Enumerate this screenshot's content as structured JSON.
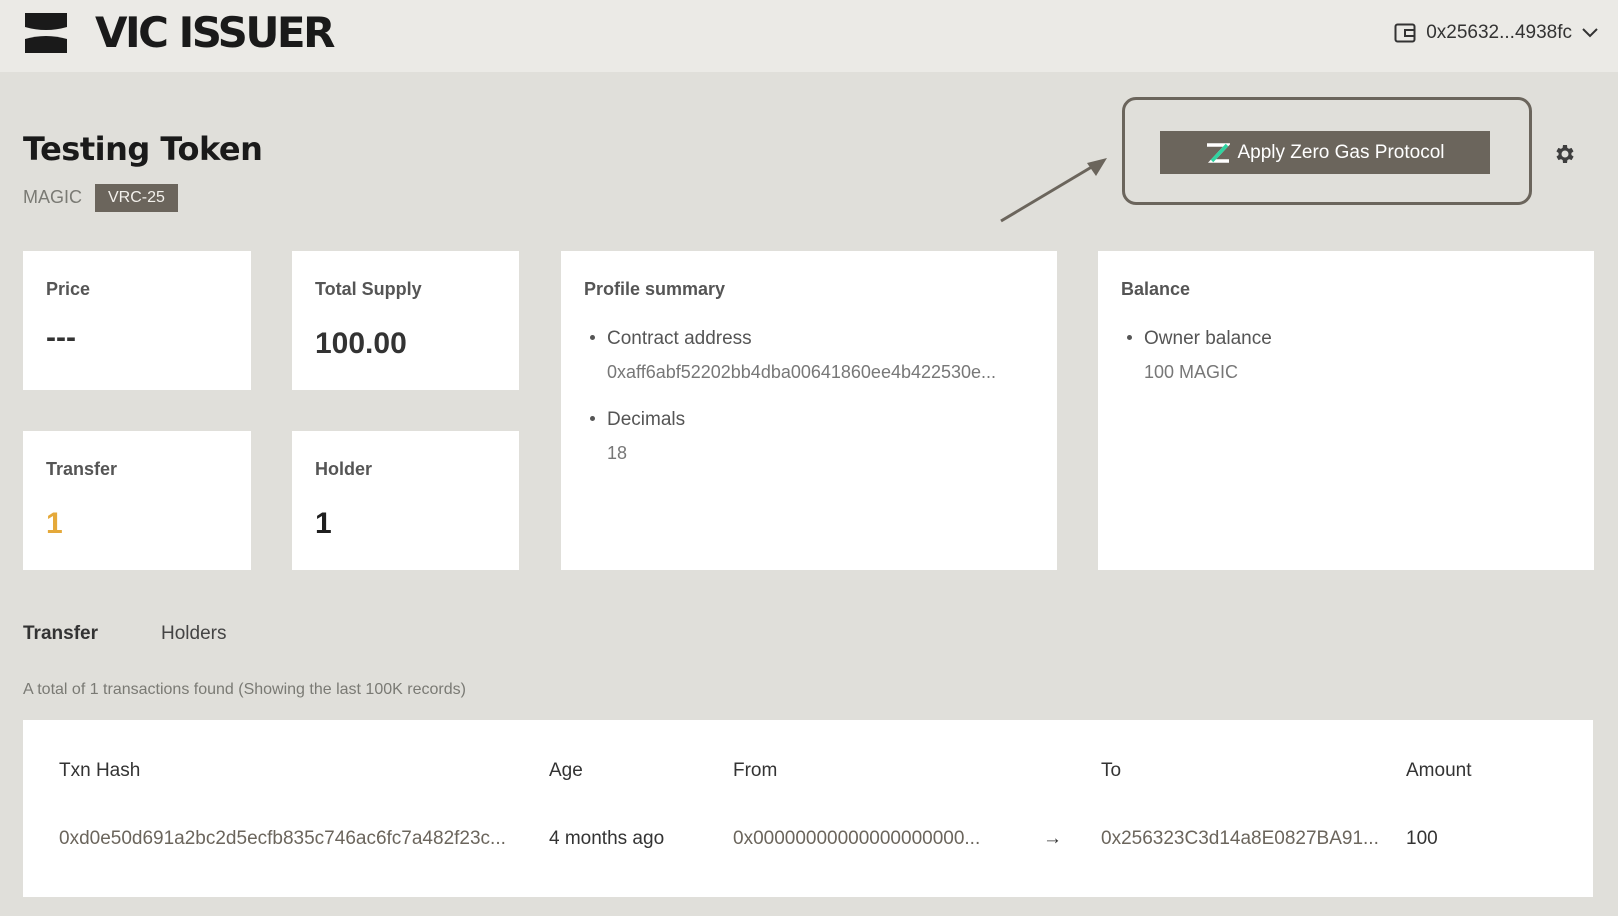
{
  "app": {
    "brand": "VIC ISSUER"
  },
  "wallet": {
    "address": "0x25632...4938fc"
  },
  "token": {
    "name": "Testing Token",
    "symbol": "MAGIC",
    "standard": "VRC-25"
  },
  "zero_gas": {
    "button_label": "Apply Zero Gas Protocol"
  },
  "stats": {
    "price": {
      "label": "Price",
      "value": "---"
    },
    "total_supply": {
      "label": "Total Supply",
      "value": "100.00"
    },
    "transfer": {
      "label": "Transfer",
      "value": "1"
    },
    "holder": {
      "label": "Holder",
      "value": "1"
    }
  },
  "profile": {
    "title": "Profile summary",
    "items": [
      {
        "label": "Contract address",
        "value": "0xaff6abf52202bb4dba00641860ee4b422530e..."
      },
      {
        "label": "Decimals",
        "value": "18"
      }
    ]
  },
  "balance": {
    "title": "Balance",
    "items": [
      {
        "label": "Owner balance",
        "value": "100 MAGIC"
      }
    ]
  },
  "tabs": [
    {
      "label": "Transfer",
      "active": true
    },
    {
      "label": "Holders",
      "active": false
    }
  ],
  "transactions": {
    "summary": "A total of 1 transactions found (Showing the last 100K records)",
    "columns": [
      "Txn Hash",
      "Age",
      "From",
      "To",
      "Amount"
    ],
    "rows": [
      {
        "hash": "0xd0e50d691a2bc2d5ecfb835c746ac6fc7a482f23c...",
        "age": "4 months ago",
        "from": "0x00000000000000000000...",
        "arrow": "→",
        "to": "0x256323C3d14a8E0827BA91...",
        "amount": "100"
      }
    ]
  },
  "colors": {
    "accent": "#6b655c",
    "highlight": "#e5a93a",
    "background": "#e0dfda",
    "zero_logo": "#2fd3a0"
  },
  "icons": [
    "logo-icon",
    "wallet-icon",
    "chevron-down-icon",
    "zero-logo-icon",
    "arrow-icon",
    "gear-icon",
    "arrow-right-icon"
  ]
}
